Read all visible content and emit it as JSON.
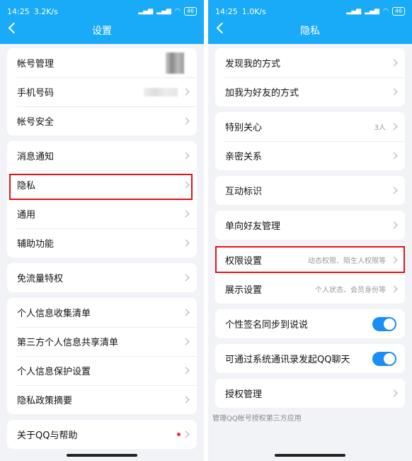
{
  "left": {
    "status": {
      "time": "14:25",
      "speed": "3.2K/s",
      "battery": "46"
    },
    "title": "设置",
    "groups": [
      [
        {
          "label": "帐号管理"
        },
        {
          "label": "手机号码"
        },
        {
          "label": "帐号安全"
        }
      ],
      [
        {
          "label": "消息通知"
        },
        {
          "label": "隐私"
        },
        {
          "label": "通用"
        },
        {
          "label": "辅助功能"
        }
      ],
      [
        {
          "label": "免流量特权"
        }
      ],
      [
        {
          "label": "个人信息收集清单"
        },
        {
          "label": "第三方个人信息共享清单"
        },
        {
          "label": "个人信息保护设置"
        },
        {
          "label": "隐私政策摘要"
        }
      ],
      [
        {
          "label": "关于QQ与帮助"
        }
      ]
    ]
  },
  "right": {
    "status": {
      "time": "14:25",
      "speed": "1.0K/s",
      "battery": "46"
    },
    "title": "隐私",
    "groups": [
      [
        {
          "label": "发现我的方式"
        },
        {
          "label": "加我为好友的方式"
        }
      ],
      [
        {
          "label": "特别关心",
          "value": "3人"
        },
        {
          "label": "亲密关系"
        }
      ],
      [
        {
          "label": "互动标识"
        }
      ],
      [
        {
          "label": "单向好友管理"
        }
      ],
      [
        {
          "label": "权限设置",
          "value": "动态权限、陌生人权限等"
        },
        {
          "label": "展示设置",
          "value": "个人状态、会员身份等"
        }
      ],
      [
        {
          "label": "个性签名同步到说说"
        }
      ],
      [
        {
          "label": "可通过系统通讯录发起QQ聊天"
        }
      ],
      [
        {
          "label": "授权管理"
        }
      ]
    ],
    "note": "管理QQ帐号授权第三方应用"
  },
  "colors": {
    "accent": "#19aaf8",
    "highlight": "#e3121a",
    "toggle": "#1a8ef5"
  }
}
